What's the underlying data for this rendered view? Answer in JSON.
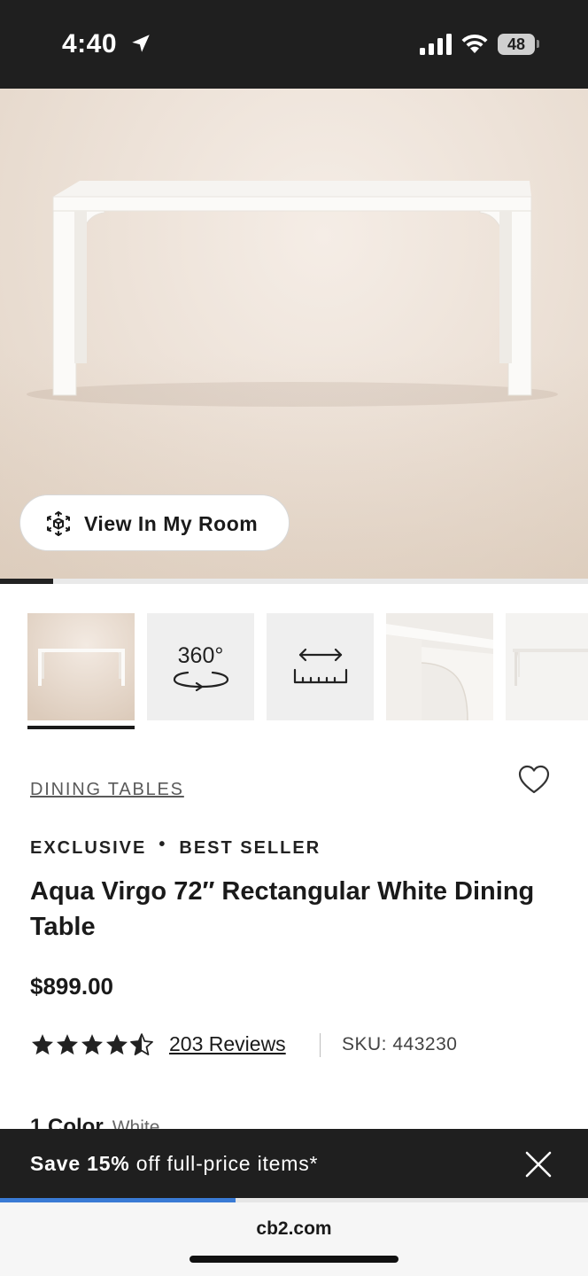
{
  "status_bar": {
    "time": "4:40",
    "battery": "48"
  },
  "hero": {
    "view_room_label": "View In My Room",
    "gallery_progress": 0.09
  },
  "thumbnails": [
    {
      "name": "product-photo",
      "selected": true
    },
    {
      "name": "360-view",
      "label": "360°"
    },
    {
      "name": "dimensions"
    },
    {
      "name": "detail-photo"
    },
    {
      "name": "side-photo"
    }
  ],
  "product": {
    "category": "DINING TABLES",
    "badges": [
      "EXCLUSIVE",
      "BEST SELLER"
    ],
    "badge_separator": "•",
    "title": "Aqua Virgo 72″ Rectangular White Dining Table",
    "price": "$899.00",
    "rating": 4.5,
    "reviews": "203 Reviews",
    "sku": "SKU: 443230",
    "color_count": "1 Color",
    "color_value": "White"
  },
  "promo": {
    "text_bold": "Save 15%",
    "text_rest": " off full-price items*"
  },
  "browser": {
    "url": "cb2.com",
    "load_progress": 0.4
  },
  "colors": {
    "dark": "#1f1f1f",
    "accent_blue": "#3a7bd5"
  }
}
